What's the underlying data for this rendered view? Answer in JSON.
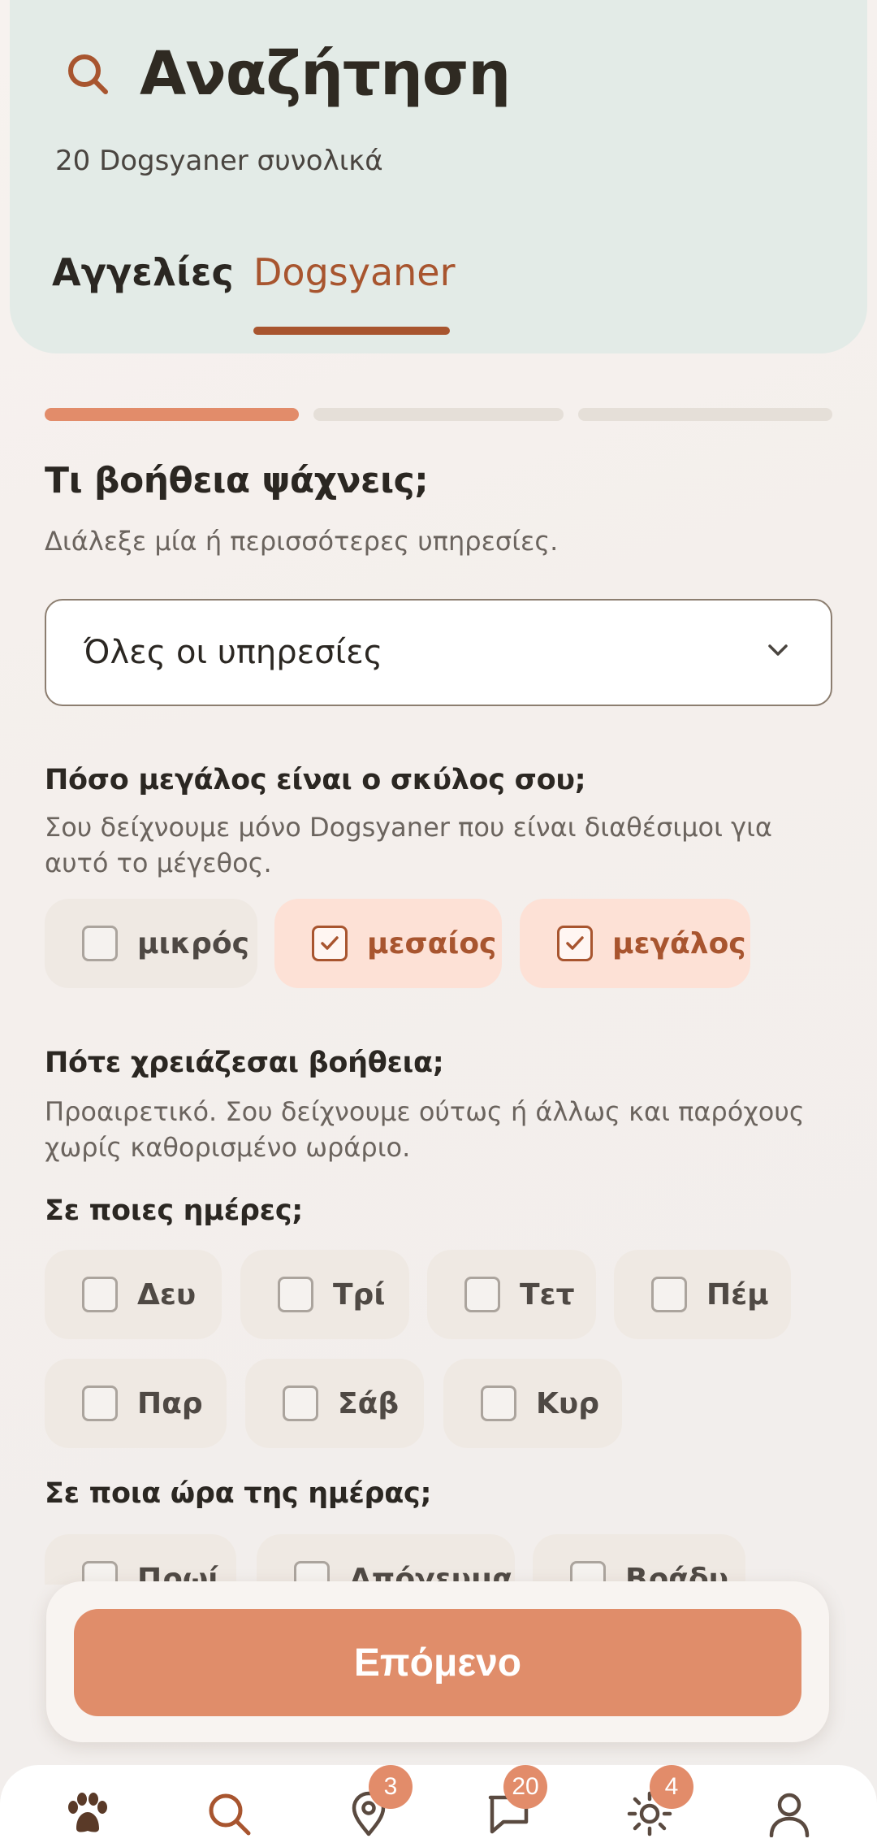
{
  "header": {
    "title": "Αναζήτηση",
    "subtitle": "20 Dogsyaner συνολικά",
    "tabs": [
      {
        "label": "Αγγελίες",
        "active": false
      },
      {
        "label": "Dogsyaner",
        "active": true
      }
    ]
  },
  "progress": {
    "step": 1,
    "total": 3
  },
  "services": {
    "title": "Τι βοήθεια ψάχνεις;",
    "description": "Διάλεξε μία ή περισσότερες υπηρεσίες.",
    "selected": "Όλες οι υπηρεσίες"
  },
  "size": {
    "title": "Πόσο μεγάλος είναι ο σκύλος σου;",
    "description": "Σου δείχνουμε μόνο Dogsyaner που είναι διαθέσιμοι για αυτό το μέγεθος.",
    "options": [
      {
        "label": "μικρός",
        "checked": false
      },
      {
        "label": "μεσαίος",
        "checked": true
      },
      {
        "label": "μεγάλος",
        "checked": true
      }
    ]
  },
  "when": {
    "title": "Πότε χρειάζεσαι βοήθεια;",
    "description": "Προαιρετικό. Σου δείχνουμε ούτως ή άλλως και παρόχους χωρίς καθορισμένο ωράριο.",
    "days_title": "Σε ποιες ημέρες;",
    "days": [
      {
        "label": "Δευ",
        "checked": false
      },
      {
        "label": "Τρί",
        "checked": false
      },
      {
        "label": "Τετ",
        "checked": false
      },
      {
        "label": "Πέμ",
        "checked": false
      },
      {
        "label": "Παρ",
        "checked": false
      },
      {
        "label": "Σάβ",
        "checked": false
      },
      {
        "label": "Κυρ",
        "checked": false
      }
    ],
    "time_title": "Σε ποια ώρα της ημέρας;",
    "times": [
      {
        "label": "Πρωί",
        "checked": false
      },
      {
        "label": "Απόγευμα",
        "checked": false
      },
      {
        "label": "Βράδυ",
        "checked": false
      }
    ]
  },
  "cta": {
    "label": "Επόμενο"
  },
  "nav": {
    "items": [
      {
        "icon": "paw-icon",
        "badge": ""
      },
      {
        "icon": "search-icon",
        "badge": ""
      },
      {
        "icon": "location-pin-icon",
        "badge": "3"
      },
      {
        "icon": "chat-icon",
        "badge": "20"
      },
      {
        "icon": "sun-icon",
        "badge": "4"
      },
      {
        "icon": "profile-icon",
        "badge": ""
      }
    ]
  },
  "colors": {
    "accent": "#a8552f",
    "cta": "#e08d6a",
    "header_bg": "#e3ebe7",
    "chip_selected": "#fde1d6"
  }
}
